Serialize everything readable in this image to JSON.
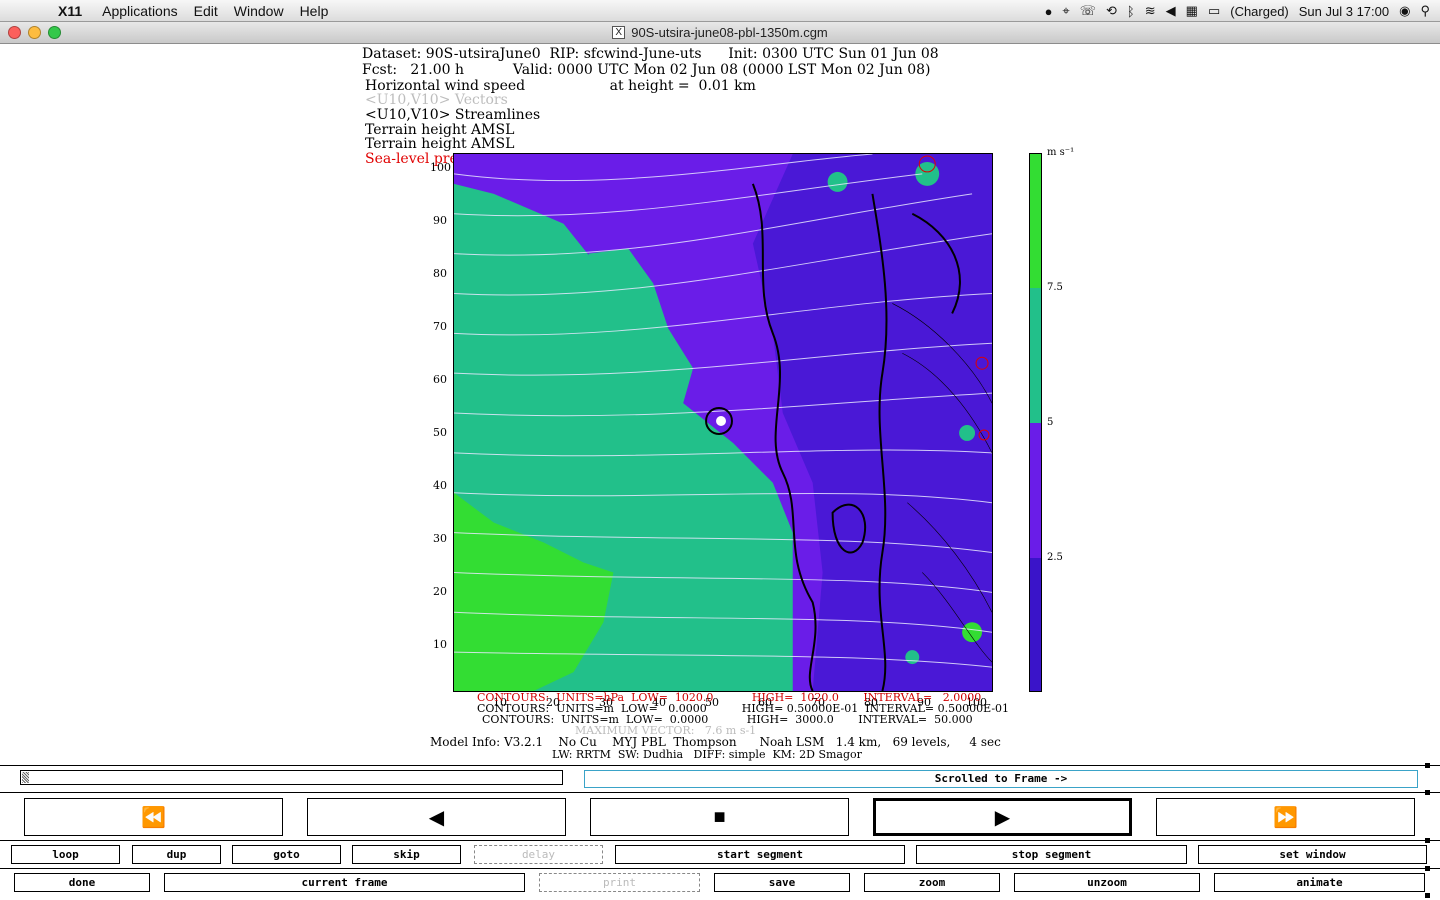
{
  "menubar": {
    "app": "X11",
    "items": [
      "Applications",
      "Edit",
      "Window",
      "Help"
    ],
    "battery": "(Charged)",
    "clock": "Sun Jul 3  17:00"
  },
  "window": {
    "title": "90S-utsira-june08-pbl-1350m.cgm"
  },
  "header": {
    "line1": "Dataset: 90S-utsiraJune0  RIP: sfcwind-June-uts      Init: 0300 UTC Sun 01 Jun 08",
    "line2": "Fcst:   21.00 h           Valid: 0000 UTC Mon 02 Jun 08 (0000 LST Mon 02 Jun 08)",
    "line3": "Horizontal wind speed                   at height =  0.01 km",
    "line4": "<U10,V10> Vectors",
    "line5": "<U10,V10> Streamlines",
    "line6": "Terrain height AMSL",
    "line7": "Terrain height AMSL",
    "line8": "Sea-level pressure"
  },
  "plot": {
    "y_ticks": [
      "100",
      "90",
      "80",
      "70",
      "60",
      "50",
      "40",
      "30",
      "20",
      "10"
    ],
    "x_ticks": [
      "10",
      "20",
      "30",
      "40",
      "50",
      "60",
      "70",
      "80",
      "90",
      "100"
    ],
    "colorbar_unit": "m s⁻¹",
    "colorbar_labels": [
      "7.5",
      "5",
      "2.5"
    ],
    "colors": {
      "high": "#33dd33",
      "mid_high": "#22c08a",
      "mid": "#6a1de8",
      "low": "#3a14c9",
      "contour_red": "#e00000"
    }
  },
  "footer": {
    "c1": "CONTOURS:  UNITS=hPa  LOW=  1020.0           HIGH=  1020.0       INTERVAL=   2.0000",
    "c2": "CONTOURS:  UNITS=m  LOW=   0.0000          HIGH= 0.50000E-01  INTERVAL= 0.50000E-01",
    "c3": "CONTOURS:  UNITS=m  LOW=  0.0000           HIGH=  3000.0       INTERVAL=  50.000",
    "maxvec": "MAXIMUM VECTOR:   7.6 m s-1",
    "model1": "Model Info: V3.2.1    No Cu    MYJ PBL  Thompson      Noah LSM   1.4 km,   69 levels,     4 sec",
    "model2": "LW: RRTM  SW: Dudhia   DIFF: simple  KM: 2D Smagor"
  },
  "controls": {
    "frame_message": "Scrolled to Frame ->",
    "big_buttons": [
      "⏪",
      "◀",
      "■",
      "▶",
      "⏩"
    ],
    "row1": [
      "loop",
      "dup",
      "goto",
      "skip",
      "delay",
      "start segment",
      "stop segment",
      "set window"
    ],
    "row2": [
      "done",
      "current frame",
      "print",
      "save",
      "zoom",
      "unzoom",
      "animate"
    ]
  }
}
